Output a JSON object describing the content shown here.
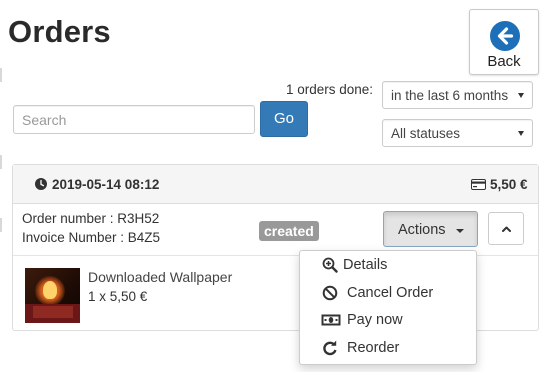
{
  "header": {
    "title": "Orders",
    "back_label": "Back"
  },
  "filters": {
    "orders_done_label": "1 orders done:",
    "period_value": "in the last 6 months",
    "status_value": "All statuses",
    "search_placeholder": "Search",
    "go_label": "Go"
  },
  "order": {
    "datetime": "2019-05-14 08:12",
    "total": "5,50 €",
    "order_number": "Order number : R3H52",
    "invoice_number": "Invoice Number : B4Z5",
    "status": "created",
    "actions_label": "Actions",
    "items": [
      {
        "name": "Downloaded Wallpaper",
        "qty": "1 x 5,50 €"
      }
    ]
  },
  "actions_menu": [
    {
      "label": "Details",
      "icon": "zoom-in-icon"
    },
    {
      "label": "Cancel Order",
      "icon": "ban-icon"
    },
    {
      "label": "Pay now",
      "icon": "money-icon"
    },
    {
      "label": "Reorder",
      "icon": "redo-icon"
    }
  ],
  "colors": {
    "primary": "#337ab7",
    "back_icon": "#1c6fb8",
    "badge": "#999999",
    "panel_head": "#f5f5f5"
  }
}
